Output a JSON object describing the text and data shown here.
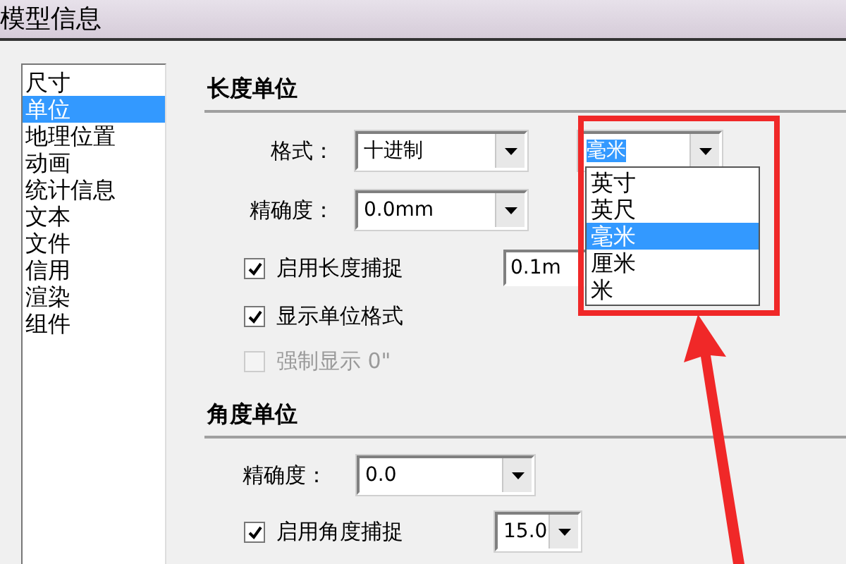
{
  "window": {
    "title": "模型信息"
  },
  "sidebar": {
    "items": [
      {
        "label": "尺寸",
        "selected": false
      },
      {
        "label": "单位",
        "selected": true
      },
      {
        "label": "地理位置",
        "selected": false
      },
      {
        "label": "动画",
        "selected": false
      },
      {
        "label": "统计信息",
        "selected": false
      },
      {
        "label": "文本",
        "selected": false
      },
      {
        "label": "文件",
        "selected": false
      },
      {
        "label": "信用",
        "selected": false
      },
      {
        "label": "渲染",
        "selected": false
      },
      {
        "label": "组件",
        "selected": false
      }
    ]
  },
  "length_units": {
    "heading": "长度单位",
    "format": {
      "label": "格式：",
      "value": "十进制"
    },
    "unit": {
      "value": "毫米",
      "expanded": true,
      "options": [
        {
          "label": "英寸",
          "selected": false
        },
        {
          "label": "英尺",
          "selected": false
        },
        {
          "label": "毫米",
          "selected": true
        },
        {
          "label": "厘米",
          "selected": false
        },
        {
          "label": "米",
          "selected": false
        }
      ]
    },
    "precision": {
      "label": "精确度：",
      "value": "0.0mm"
    },
    "snapping": {
      "label": "启用长度捕捉",
      "checked": true,
      "disabled": false,
      "value": "0.1m"
    },
    "display_format": {
      "label": "显示单位格式",
      "checked": true,
      "disabled": false
    },
    "force_inches": {
      "label": "强制显示 0\"",
      "checked": false,
      "disabled": true
    }
  },
  "angle_units": {
    "heading": "角度单位",
    "precision": {
      "label": "精确度：",
      "value": "0.0"
    },
    "snapping": {
      "label": "启用角度捕捉",
      "checked": true,
      "disabled": false,
      "value": "15.0"
    }
  }
}
